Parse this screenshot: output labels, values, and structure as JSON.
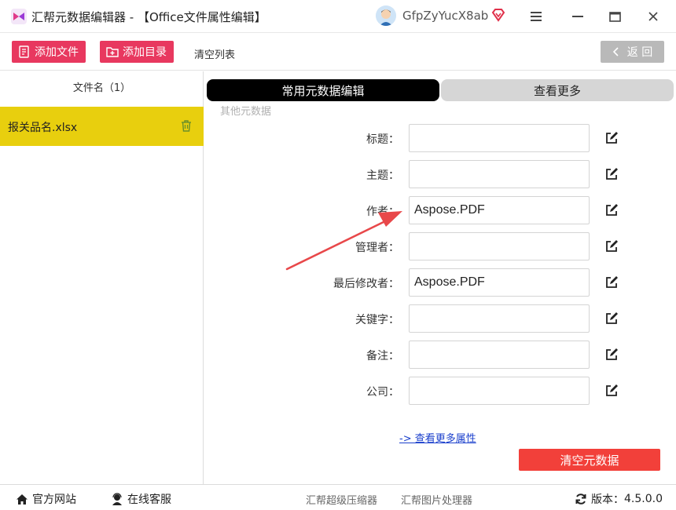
{
  "window": {
    "title": "汇帮元数据编辑器 - 【Office文件属性编辑】",
    "username": "GfpZyYucX8ab"
  },
  "toolbar": {
    "add_file_label": "添加文件",
    "add_dir_label": "添加目录",
    "clear_list_label": "清空列表",
    "back_label": "返 回"
  },
  "file_list": {
    "header": "文件名（1）",
    "files": [
      "报关品名.xlsx"
    ]
  },
  "tabs": {
    "common": "常用元数据编辑",
    "more": "查看更多"
  },
  "section_label": "其他元数据",
  "fields": [
    {
      "label": "标题：",
      "value": ""
    },
    {
      "label": "主题：",
      "value": ""
    },
    {
      "label": "作者：",
      "value": "Aspose.PDF"
    },
    {
      "label": "管理者：",
      "value": ""
    },
    {
      "label": "最后修改者：",
      "value": "Aspose.PDF"
    },
    {
      "label": "关键字：",
      "value": ""
    },
    {
      "label": "备注：",
      "value": ""
    },
    {
      "label": "公司：",
      "value": ""
    }
  ],
  "more_link": "-> 查看更多属性",
  "clear_metadata_label": "清空元数据",
  "statusbar": {
    "website": "官方网站",
    "support": "在线客服",
    "compressor": "汇帮超级压缩器",
    "image_tool": "汇帮图片处理器",
    "version_label": "版本：",
    "version": "4.5.0.0"
  },
  "colors": {
    "accent_pink": "#e8385f",
    "selected_file": "#e8cf0e",
    "clear_button": "#f2403a",
    "arrow": "#e8484a"
  }
}
